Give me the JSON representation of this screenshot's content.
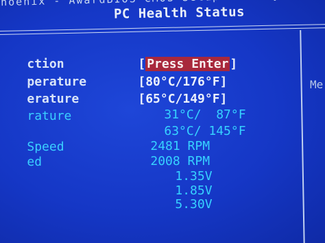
{
  "header": {
    "top_text": "Phoenix - AwardBIOS CMOS Setup Utility",
    "title": "PC Health Status",
    "help_text": "Me"
  },
  "rows": [
    {
      "label": "ction",
      "value": "Press Enter",
      "type": "action"
    },
    {
      "label": "perature",
      "value": "80°C/176°F",
      "type": "bracket"
    },
    {
      "label": "erature",
      "value": "65°C/149°F",
      "type": "bracket"
    },
    {
      "label": "rature",
      "value": "31°C/  87°F",
      "type": "readout"
    },
    {
      "label": "",
      "value": "63°C/ 145°F",
      "type": "readout"
    },
    {
      "label": "Speed",
      "value": "2481 RPM",
      "type": "readout"
    },
    {
      "label": "ed",
      "value": "2008 RPM",
      "type": "readout"
    },
    {
      "label": "",
      "value": "1.35V",
      "type": "readout"
    },
    {
      "label": "",
      "value": "1.85V",
      "type": "readout"
    },
    {
      "label": "",
      "value": "5.30V",
      "type": "readout"
    }
  ]
}
